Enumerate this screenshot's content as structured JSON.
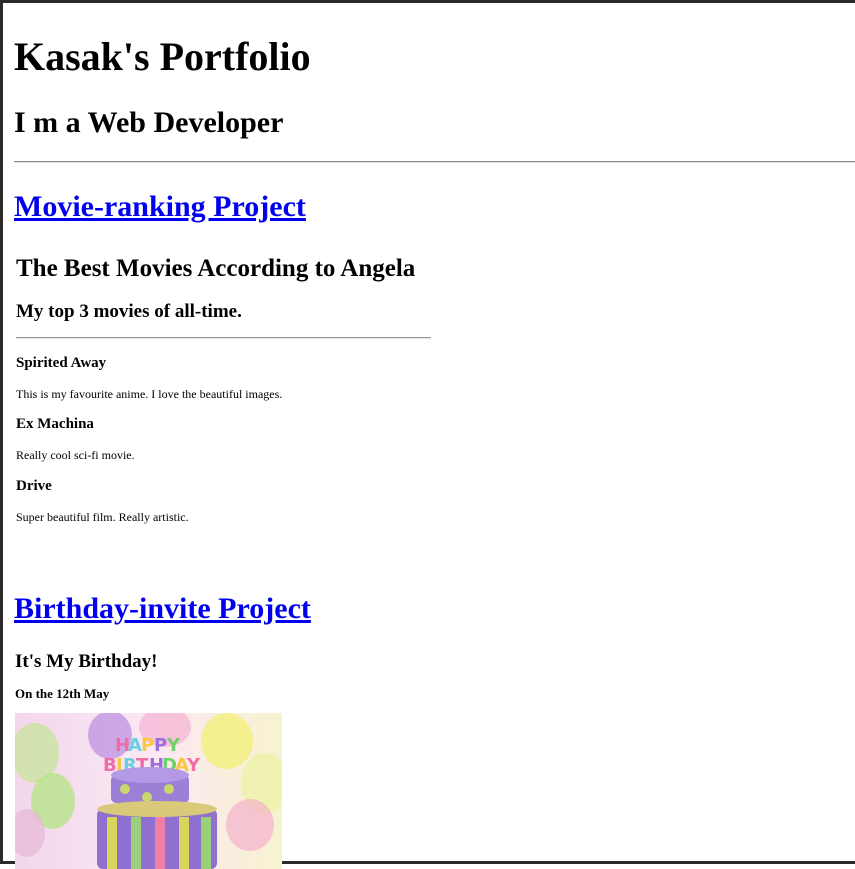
{
  "header": {
    "title": "Kasak's Portfolio",
    "subtitle": "I m a Web Developer"
  },
  "projects": [
    {
      "link_label": "Movie-ranking Project",
      "embed": {
        "title": "The Best Movies According to Angela",
        "subtitle": "My top 3 movies of all-time.",
        "movies": [
          {
            "name": "Spirited Away",
            "description": "This is my favourite anime. I love the beautiful images."
          },
          {
            "name": "Ex Machina",
            "description": "Really cool sci-fi movie."
          },
          {
            "name": "Drive",
            "description": "Super beautiful film. Really artistic."
          }
        ]
      }
    },
    {
      "link_label": "Birthday-invite Project",
      "embed": {
        "title": "It's My Birthday!",
        "date": "On the 12th May",
        "image_text": "HAPPY BIRTHDAY"
      }
    }
  ],
  "colors": {
    "link": "#0000ee",
    "background": "#ffffff"
  }
}
